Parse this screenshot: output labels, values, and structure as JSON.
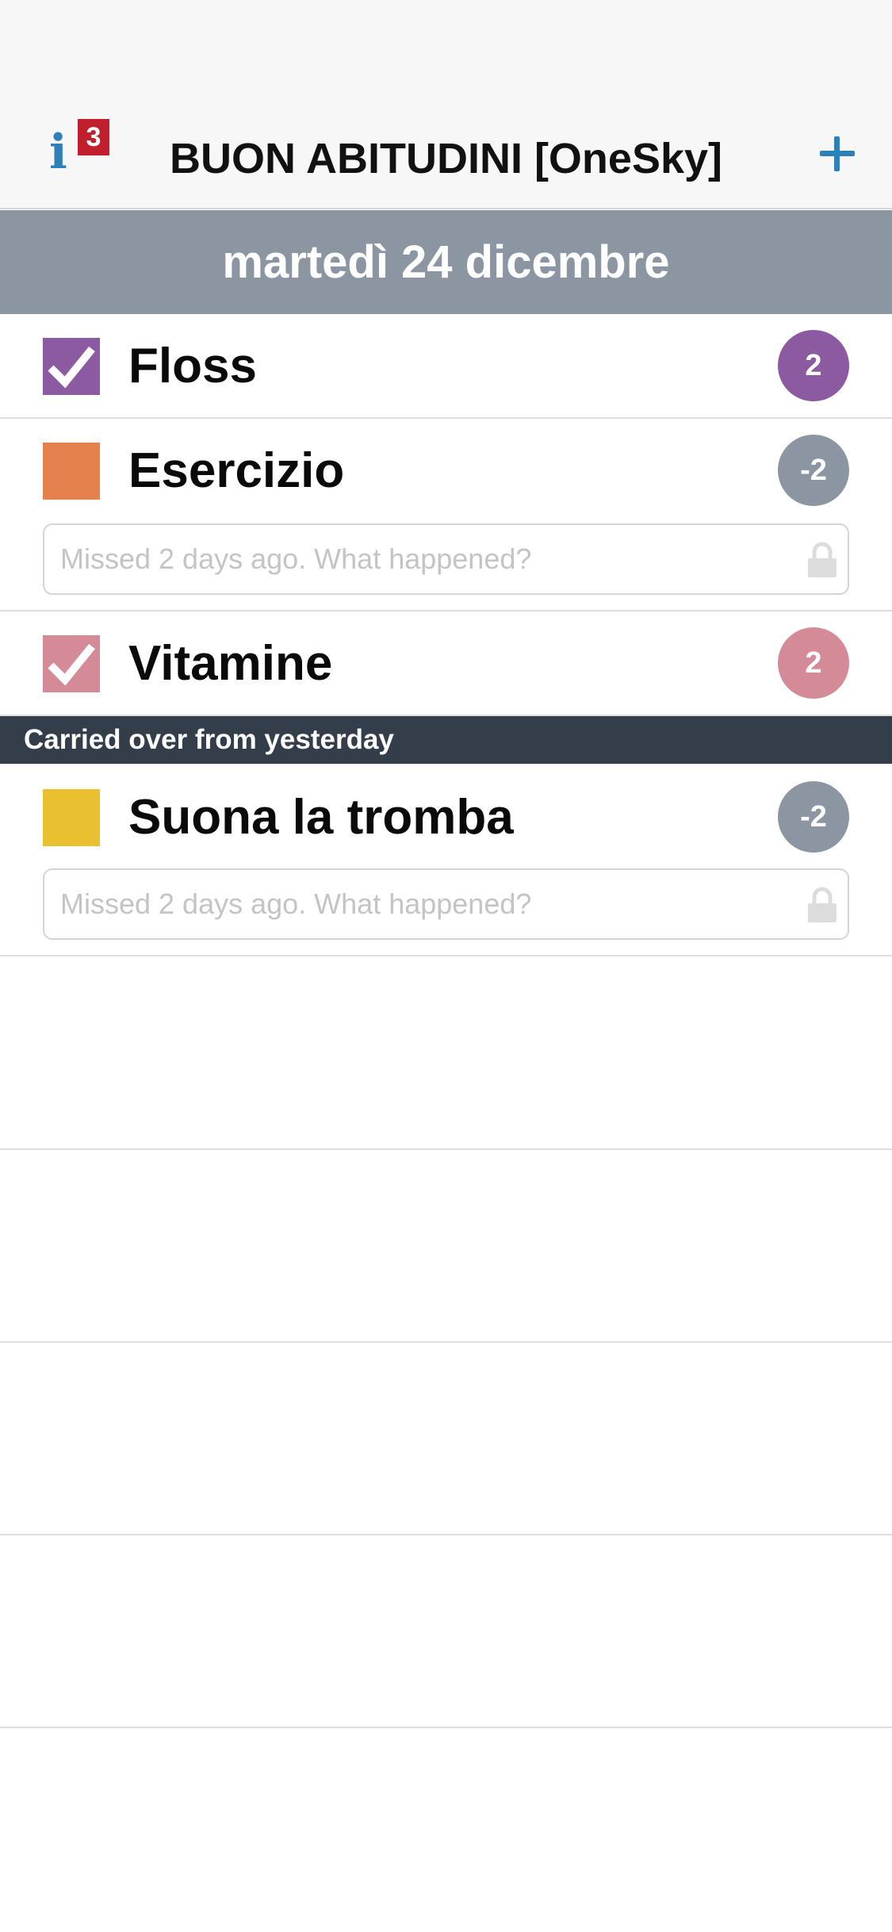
{
  "header": {
    "title": "BUON ABITUDINI [OneSky]",
    "info_icon_letter": "i",
    "info_badge_count": "3",
    "add_icon": "plus-icon"
  },
  "date_bar": {
    "label": "martedì 24 dicembre"
  },
  "habits": [
    {
      "name": "Floss",
      "score": "2",
      "checked": true,
      "color": "#8b5aa0",
      "score_color": "#8b5aa0"
    },
    {
      "name": "Esercizio",
      "score": "-2",
      "checked": false,
      "color": "#e5804f",
      "score_color": "#8b96a2",
      "note_placeholder": "Missed 2 days ago. What happened?"
    },
    {
      "name": "Vitamine",
      "score": "2",
      "checked": true,
      "color": "#d58a98",
      "score_color": "#d58a98"
    }
  ],
  "carried_over": {
    "label": "Carried over from yesterday",
    "habits": [
      {
        "name": "Suona la tromba",
        "score": "-2",
        "checked": false,
        "color": "#e8c030",
        "score_color": "#8b96a2",
        "note_placeholder": "Missed 2 days ago. What happened?"
      }
    ]
  },
  "colors": {
    "accent_blue": "#2f7fb8",
    "badge_red": "#c0202e",
    "date_bar_bg": "#8b96a2",
    "section_bar_bg": "#343e4a"
  }
}
